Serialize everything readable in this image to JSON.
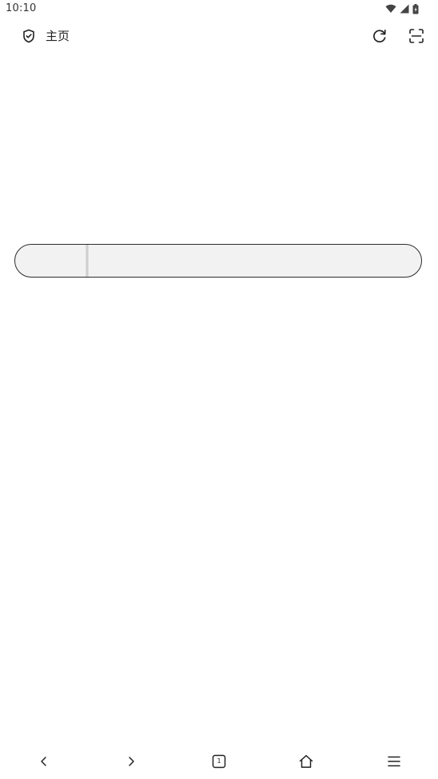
{
  "status_bar": {
    "time": "10:10",
    "icons": [
      "wifi-icon",
      "cell-signal-icon",
      "battery-icon"
    ]
  },
  "top_bar": {
    "title": "主页",
    "left_icon": "shield-check-icon",
    "right_icons": [
      "refresh-icon",
      "scan-icon"
    ]
  },
  "search": {
    "value": "",
    "placeholder": ""
  },
  "bottom_nav": {
    "items": [
      "back-icon",
      "forward-icon",
      "tabs-icon",
      "home-icon",
      "menu-icon"
    ],
    "tab_count": "1"
  },
  "colors": {
    "background": "#ffffff",
    "search_fill": "#f2f2f2",
    "search_border": "#2b2b2b",
    "icon": "#222222"
  }
}
